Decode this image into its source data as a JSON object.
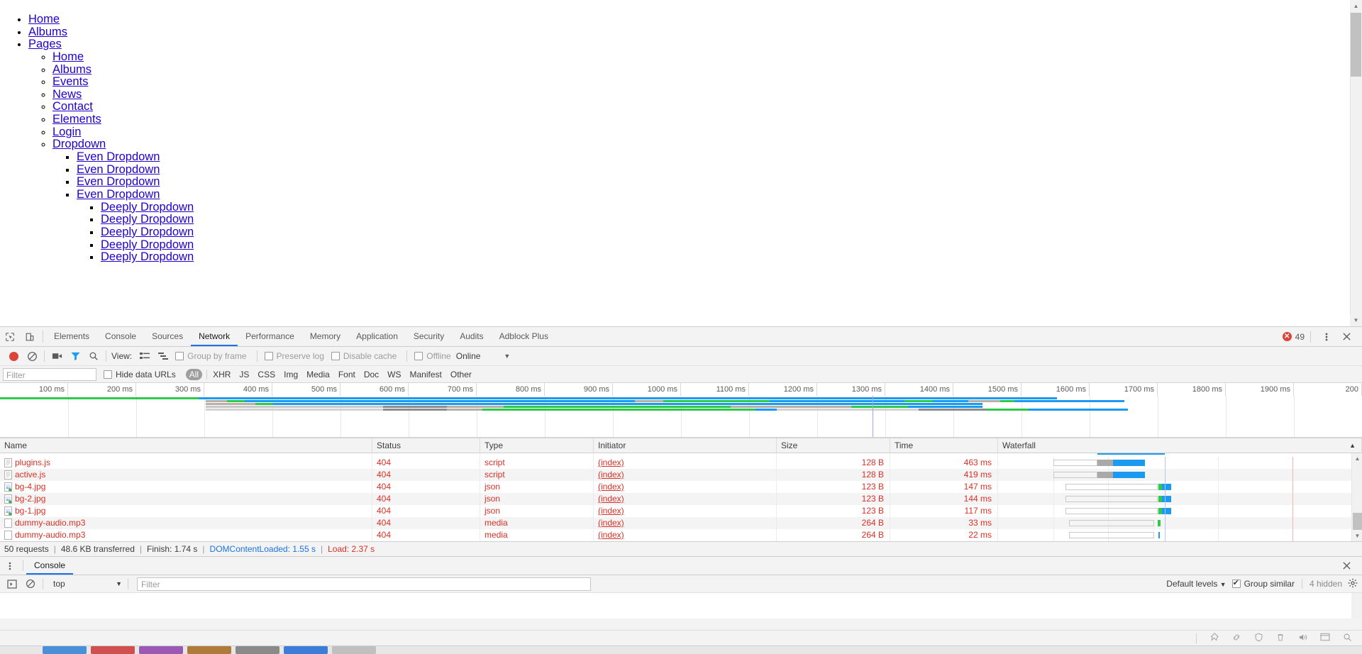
{
  "page": {
    "nav": [
      {
        "label": "Home",
        "level": 1
      },
      {
        "label": "Albums",
        "level": 1
      },
      {
        "label": "Pages",
        "level": 1
      },
      {
        "label": "Home",
        "level": 2
      },
      {
        "label": "Albums",
        "level": 2
      },
      {
        "label": "Events",
        "level": 2
      },
      {
        "label": "News",
        "level": 2
      },
      {
        "label": "Contact",
        "level": 2
      },
      {
        "label": "Elements",
        "level": 2
      },
      {
        "label": "Login",
        "level": 2
      },
      {
        "label": "Dropdown",
        "level": 2
      },
      {
        "label": "Even Dropdown",
        "level": 3
      },
      {
        "label": "Even Dropdown",
        "level": 3
      },
      {
        "label": "Even Dropdown",
        "level": 3
      },
      {
        "label": "Even Dropdown",
        "level": 3
      },
      {
        "label": "Deeply Dropdown",
        "level": 4
      },
      {
        "label": "Deeply Dropdown",
        "level": 4
      },
      {
        "label": "Deeply Dropdown",
        "level": 4
      },
      {
        "label": "Deeply Dropdown",
        "level": 4
      },
      {
        "label": "Deeply Dropdown",
        "level": 4
      }
    ],
    "link_color": "#2200cc"
  },
  "devtools": {
    "tabs": [
      {
        "label": "Elements",
        "active": false
      },
      {
        "label": "Console",
        "active": false
      },
      {
        "label": "Sources",
        "active": false
      },
      {
        "label": "Network",
        "active": true
      },
      {
        "label": "Performance",
        "active": false
      },
      {
        "label": "Memory",
        "active": false
      },
      {
        "label": "Application",
        "active": false
      },
      {
        "label": "Security",
        "active": false
      },
      {
        "label": "Audits",
        "active": false
      },
      {
        "label": "Adblock Plus",
        "active": false
      }
    ],
    "error_count": "49",
    "inspect_icon": "inspect-element-icon",
    "device_icon": "device-toolbar-icon",
    "more_icon": "more-options-icon",
    "close_icon": "close-icon",
    "accent": "#1a73e8"
  },
  "network_toolbar": {
    "record_title": "record-button",
    "clear_title": "clear-button",
    "capture_screenshots": "camera-icon",
    "filter_icon": "filter-icon",
    "search_icon": "search-icon",
    "view_label": "View:",
    "view_list_icon": "list-view-icon",
    "view_waterfall_icon": "waterfall-view-icon",
    "group_by_frame": "Group by frame",
    "preserve_log": "Preserve log",
    "disable_cache": "Disable cache",
    "offline": "Offline",
    "throttling": "Online",
    "throttling_caret": "▼"
  },
  "filter_bar": {
    "placeholder": "Filter",
    "value": "",
    "hide_data_urls": "Hide data URLs",
    "types": [
      "All",
      "XHR",
      "JS",
      "CSS",
      "Img",
      "Media",
      "Font",
      "Doc",
      "WS",
      "Manifest",
      "Other"
    ],
    "selected_type": "All"
  },
  "overview": {
    "ticks": [
      "100 ms",
      "200 ms",
      "300 ms",
      "400 ms",
      "500 ms",
      "600 ms",
      "700 ms",
      "800 ms",
      "900 ms",
      "1000 ms",
      "1100 ms",
      "1200 ms",
      "1300 ms",
      "1400 ms",
      "1500 ms",
      "1600 ms",
      "1700 ms",
      "1800 ms",
      "1900 ms",
      "200"
    ],
    "tick_interval_ms": 100,
    "max_ms": 2000
  },
  "table": {
    "columns": [
      "Name",
      "Status",
      "Type",
      "Initiator",
      "Size",
      "Time",
      "Waterfall"
    ],
    "sort_indicator": "▲",
    "rows": [
      {
        "name": "plugins.js",
        "icon": "script-file-icon",
        "status": "404",
        "type": "script",
        "initiator": "(index)",
        "size": "128 B",
        "time": "463 ms"
      },
      {
        "name": "active.js",
        "icon": "script-file-icon",
        "status": "404",
        "type": "script",
        "initiator": "(index)",
        "size": "128 B",
        "time": "419 ms"
      },
      {
        "name": "bg-4.jpg",
        "icon": "image-file-icon",
        "status": "404",
        "type": "json",
        "initiator": "(index)",
        "size": "123 B",
        "time": "147 ms"
      },
      {
        "name": "bg-2.jpg",
        "icon": "image-file-icon",
        "status": "404",
        "type": "json",
        "initiator": "(index)",
        "size": "123 B",
        "time": "144 ms"
      },
      {
        "name": "bg-1.jpg",
        "icon": "image-file-icon",
        "status": "404",
        "type": "json",
        "initiator": "(index)",
        "size": "123 B",
        "time": "117 ms"
      },
      {
        "name": "dummy-audio.mp3",
        "icon": "media-file-icon",
        "status": "404",
        "type": "media",
        "initiator": "(index)",
        "size": "264 B",
        "time": "33 ms"
      },
      {
        "name": "dummy-audio.mp3",
        "icon": "media-file-icon",
        "status": "404",
        "type": "media",
        "initiator": "(index)",
        "size": "264 B",
        "time": "22 ms"
      }
    ]
  },
  "summary": {
    "requests": "50 requests",
    "transferred": "48.6 KB transferred",
    "finish": "Finish: 1.74 s",
    "dom_content_loaded": "DOMContentLoaded: 1.55 s",
    "load": "Load: 2.37 s",
    "dcl_color": "#1a73e8",
    "load_color": "#d93025"
  },
  "drawer": {
    "menu_icon": "more-options-icon",
    "tab_label": "Console",
    "close_icon": "close-icon",
    "execute_icon": "execution-context-icon",
    "clear_icon": "clear-console-icon",
    "context": "top",
    "context_caret": "▼",
    "filter_placeholder": "Filter",
    "filter_value": "",
    "levels": "Default levels",
    "levels_caret": "▼",
    "group_similar": "Group similar",
    "hidden_count": "4 hidden",
    "settings_icon": "gear-icon"
  },
  "status_strip": {
    "icons": [
      "pin-icon",
      "link-icon",
      "shield-icon",
      "trash-icon",
      "speaker-icon",
      "window-icon",
      "search-icon"
    ]
  }
}
